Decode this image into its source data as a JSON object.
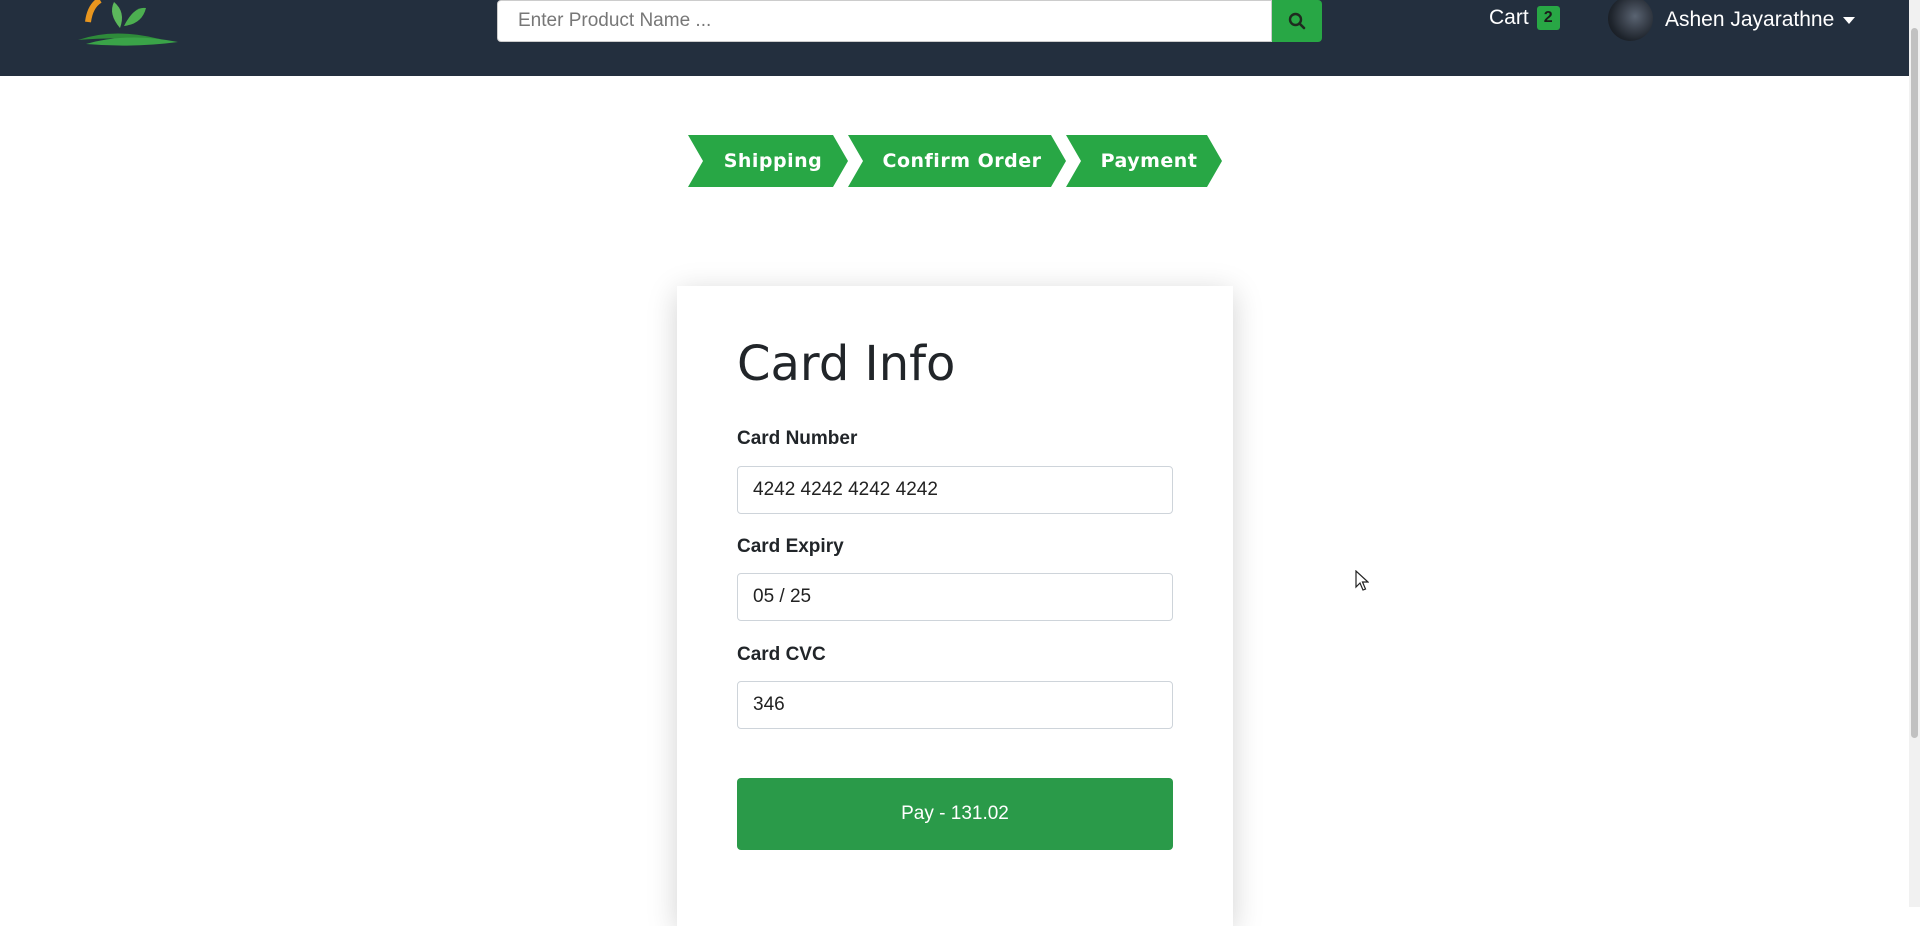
{
  "header": {
    "search_placeholder": "Enter Product Name ...",
    "search_icon": "search-icon",
    "cart_label": "Cart",
    "cart_count": "2",
    "user_name": "Ashen Jayarathne",
    "bg_color": "#232f3e"
  },
  "steps": [
    {
      "label": "Shipping"
    },
    {
      "label": "Confirm Order"
    },
    {
      "label": "Payment"
    }
  ],
  "card": {
    "title": "Card Info",
    "fields": [
      {
        "label": "Card Number",
        "value": "4242 4242 4242 4242"
      },
      {
        "label": "Card Expiry",
        "value": "05 / 25"
      },
      {
        "label": "Card CVC",
        "value": "346"
      }
    ],
    "pay_label": "Pay - 131.02"
  },
  "colors": {
    "accent": "#28a745",
    "pay_button": "#2a9a49"
  }
}
